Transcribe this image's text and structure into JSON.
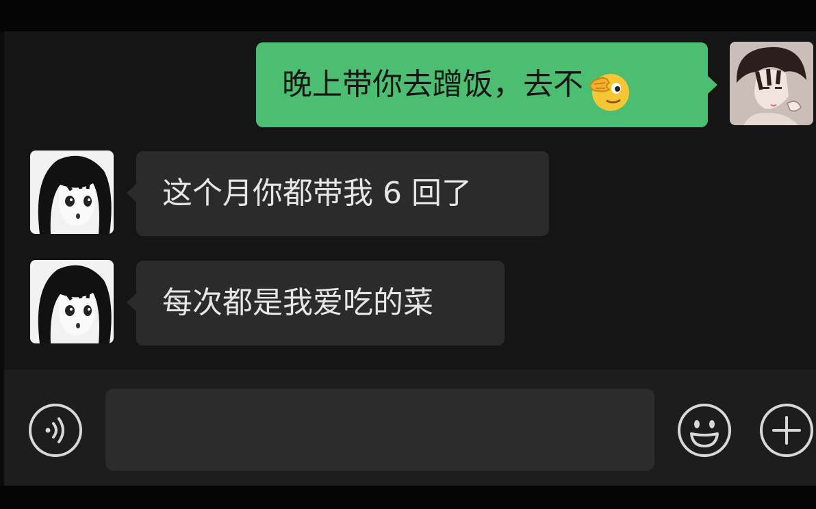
{
  "conversation": {
    "messages": [
      {
        "direction": "outgoing",
        "text": "晚上带你去蹭饭，去不",
        "emoji": "face-hand-over-eye-emoji"
      },
      {
        "direction": "incoming",
        "text": "这个月你都带我 6 回了"
      },
      {
        "direction": "incoming",
        "text": "每次都是我爱吃的菜"
      }
    ]
  },
  "input_bar": {
    "voice_icon": "voice-icon",
    "emoji_icon": "smiley-icon",
    "plus_icon": "plus-icon",
    "text_value": ""
  },
  "colors": {
    "outgoing_bubble": "#4cbe72",
    "incoming_bubble": "#2b2b2b",
    "background": "#151515"
  }
}
